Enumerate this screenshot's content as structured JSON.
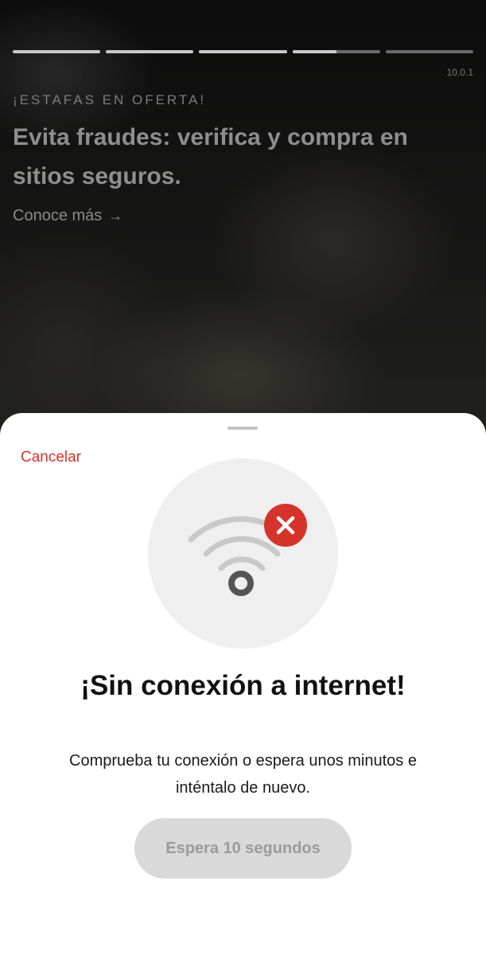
{
  "story": {
    "progress": [
      1,
      1,
      1,
      0.5,
      0
    ],
    "version": "10.0.1",
    "eyebrow": "¡ESTAFAS EN OFERTA!",
    "headline": "Evita fraudes: verifica y compra en sitios seguros.",
    "learn_more": "Conoce más",
    "learn_more_icon": "arrow-right-icon"
  },
  "sheet": {
    "cancel_label": "Cancelar",
    "illustration_icon": "wifi-off-icon",
    "title": "¡Sin conexión a internet!",
    "description": "Comprueba tu conexión o espera unos minutos e inténtalo de nuevo.",
    "wait_button_label": "Espera 10 segundos"
  },
  "colors": {
    "accent_red": "#d6332a",
    "button_disabled_bg": "#d9d9d9",
    "button_disabled_text": "#9b9b9b",
    "sheet_bg": "#ffffff"
  }
}
